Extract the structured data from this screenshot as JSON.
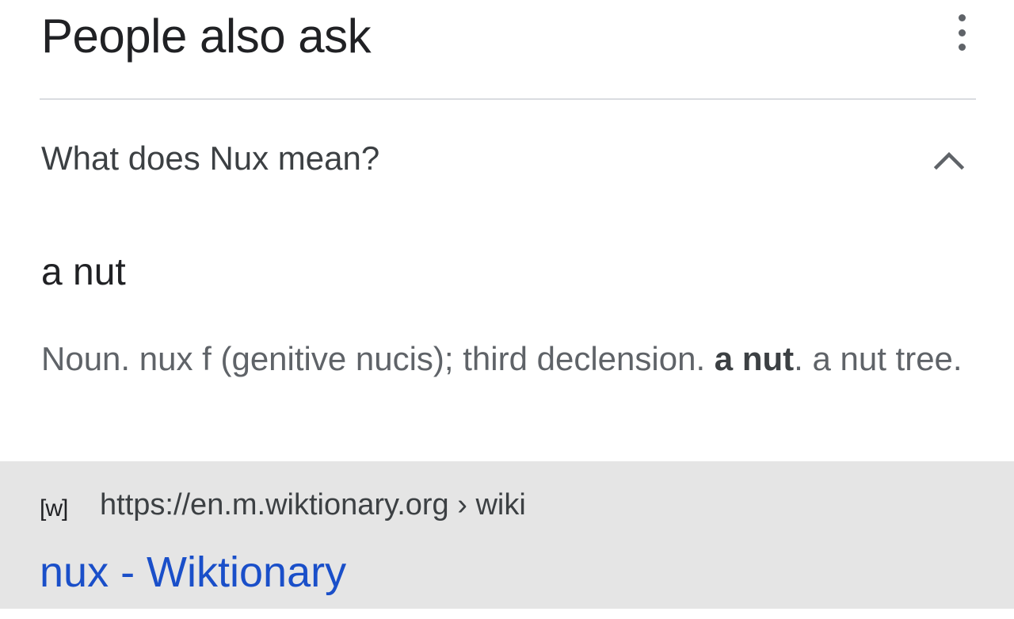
{
  "header": {
    "title": "People also ask",
    "menu_icon": "more-vertical-icon"
  },
  "question": {
    "text": "What does Nux mean?",
    "expanded": true,
    "toggle_icon": "chevron-up-icon"
  },
  "answer": {
    "title": "a nut",
    "snippet_before": "Noun. nux f (genitive nucis); third declension. ",
    "snippet_bold": "a nut",
    "snippet_after": ". a nut tree."
  },
  "source": {
    "favicon_text": "[w]",
    "url": "https://en.m.wiktionary.org › wiki",
    "title": "nux - Wiktionary",
    "link_color": "#1a4fc9"
  },
  "colors": {
    "text_primary": "#202124",
    "text_secondary": "#5f6368",
    "divider": "#dadce0",
    "source_bg": "#e5e5e5"
  }
}
